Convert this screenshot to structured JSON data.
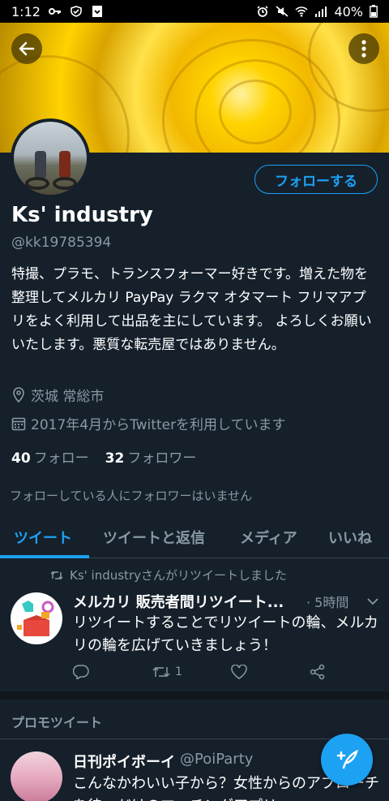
{
  "status_bar": {
    "time": "1:12",
    "battery": "40%"
  },
  "profile": {
    "name": "Ks' industry",
    "handle": "@kk19785394",
    "bio": "特撮、プラモ、トランスフォーマー好きです。増えた物を整理してメルカリ PayPay ラクマ オタマート フリマアプリをよく利用して出品を主にしています。 よろしくお願いいたします。悪質な転売屋ではありません。",
    "location": "茨城 常総市",
    "joined": "2017年4月からTwitterを利用しています",
    "following_count": "40",
    "following_label": "フォロー",
    "followers_count": "32",
    "followers_label": "フォロワー",
    "no_mutual": "フォローしている人にフォロワーはいません",
    "follow_button": "フォローする"
  },
  "tabs": [
    "ツイート",
    "ツイートと返信",
    "メディア",
    "いいね"
  ],
  "tweet": {
    "retweet_note": "Ks' industryさんがリツイートしました",
    "author": "メルカリ 販売者間リツイート...",
    "time": "· 5時間",
    "text": "リツイートすることでリツイートの輪、メルカリの輪を広げていきましょう！",
    "retweet_count": "1"
  },
  "promo": {
    "label": "プロモツイート",
    "author": "日刊ポイボーイ",
    "handle": "@PoiParty",
    "text": "こんなかわいい子から？女性からのアプローチを待つだけのマッチングアプリ"
  },
  "colors": {
    "accent": "#1da1f2",
    "background": "#15202b",
    "muted": "#8899a6"
  },
  "icons": [
    "back-arrow-icon",
    "more-vertical-icon",
    "location-pin-icon",
    "calendar-icon",
    "retweet-icon",
    "reply-icon",
    "like-icon",
    "share-icon",
    "chevron-down-icon",
    "compose-tweet-icon"
  ]
}
